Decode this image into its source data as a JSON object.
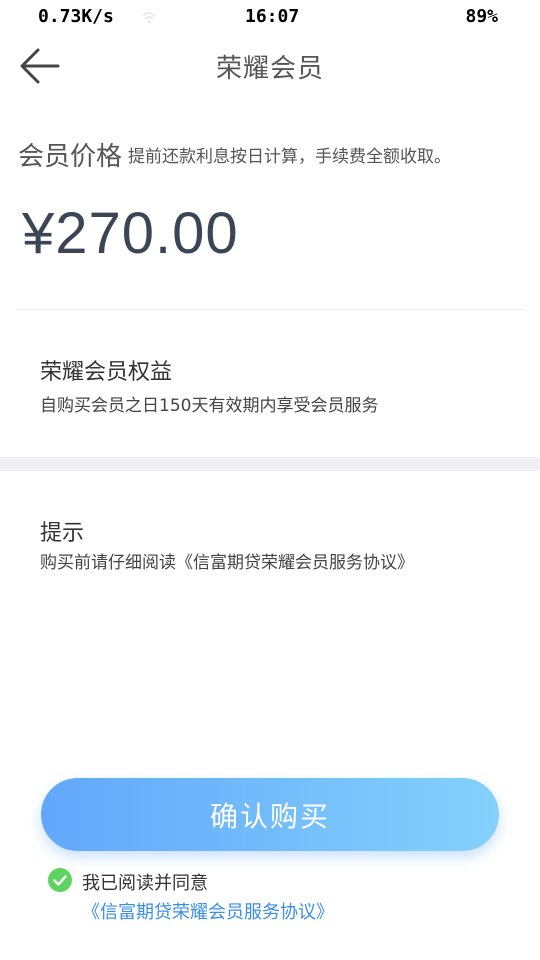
{
  "status_bar": {
    "net_speed": "0.73K/s",
    "time": "16:07",
    "battery": "89%"
  },
  "header": {
    "title": "荣耀会员",
    "back_icon": "arrow-left-icon"
  },
  "price": {
    "label": "会员价格",
    "note": "提前还款利息按日计算，手续费全额收取。",
    "value": "¥270.00"
  },
  "benefit": {
    "title": "荣耀会员权益",
    "desc": "自购买会员之日150天有效期内享受会员服务"
  },
  "tip": {
    "title": "提示",
    "desc": "购买前请仔细阅读《信富期贷荣耀会员服务协议》"
  },
  "confirm": {
    "label": "确认购买",
    "gradient_start": "#62a7fb",
    "gradient_end": "#84d1fb"
  },
  "agreement": {
    "checked": true,
    "check_icon": "check-circle-icon",
    "check_color": "#5fd35f",
    "text": "我已阅读并同意",
    "link": "《信富期贷荣耀会员服务协议》",
    "link_color": "#3a8ee6"
  }
}
